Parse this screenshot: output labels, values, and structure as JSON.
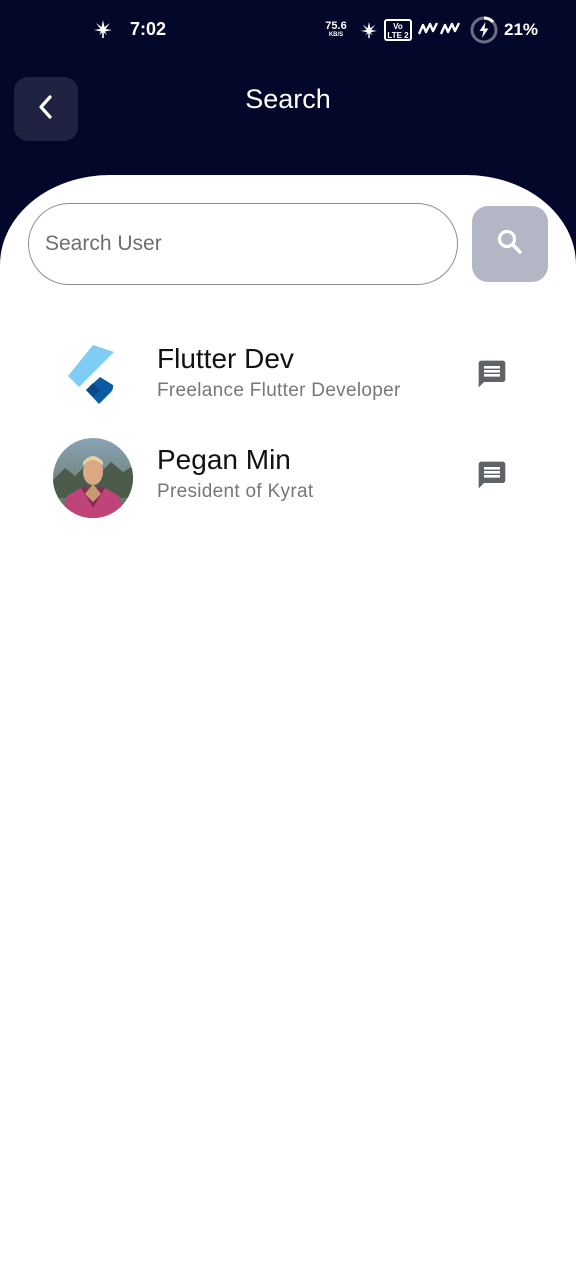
{
  "status_bar": {
    "time": "7:02",
    "net_speed": "75.6",
    "net_unit": "KB/S",
    "volte_top": "Vo",
    "volte_bottom": "LTE 2",
    "battery": "21%"
  },
  "header": {
    "title": "Search",
    "back_icon": "chevron-left-icon",
    "background": "#03072a"
  },
  "search": {
    "placeholder": "Search User",
    "value": "",
    "button_icon": "search-icon",
    "button_color": "#b3b7c5"
  },
  "users": [
    {
      "name": "Flutter Dev",
      "subtitle": "Freelance Flutter Developer",
      "avatar": "flutter-logo",
      "action_icon": "message-icon"
    },
    {
      "name": "Pegan Min",
      "subtitle": "President of Kyrat",
      "avatar": "user-photo",
      "action_icon": "message-icon"
    }
  ]
}
